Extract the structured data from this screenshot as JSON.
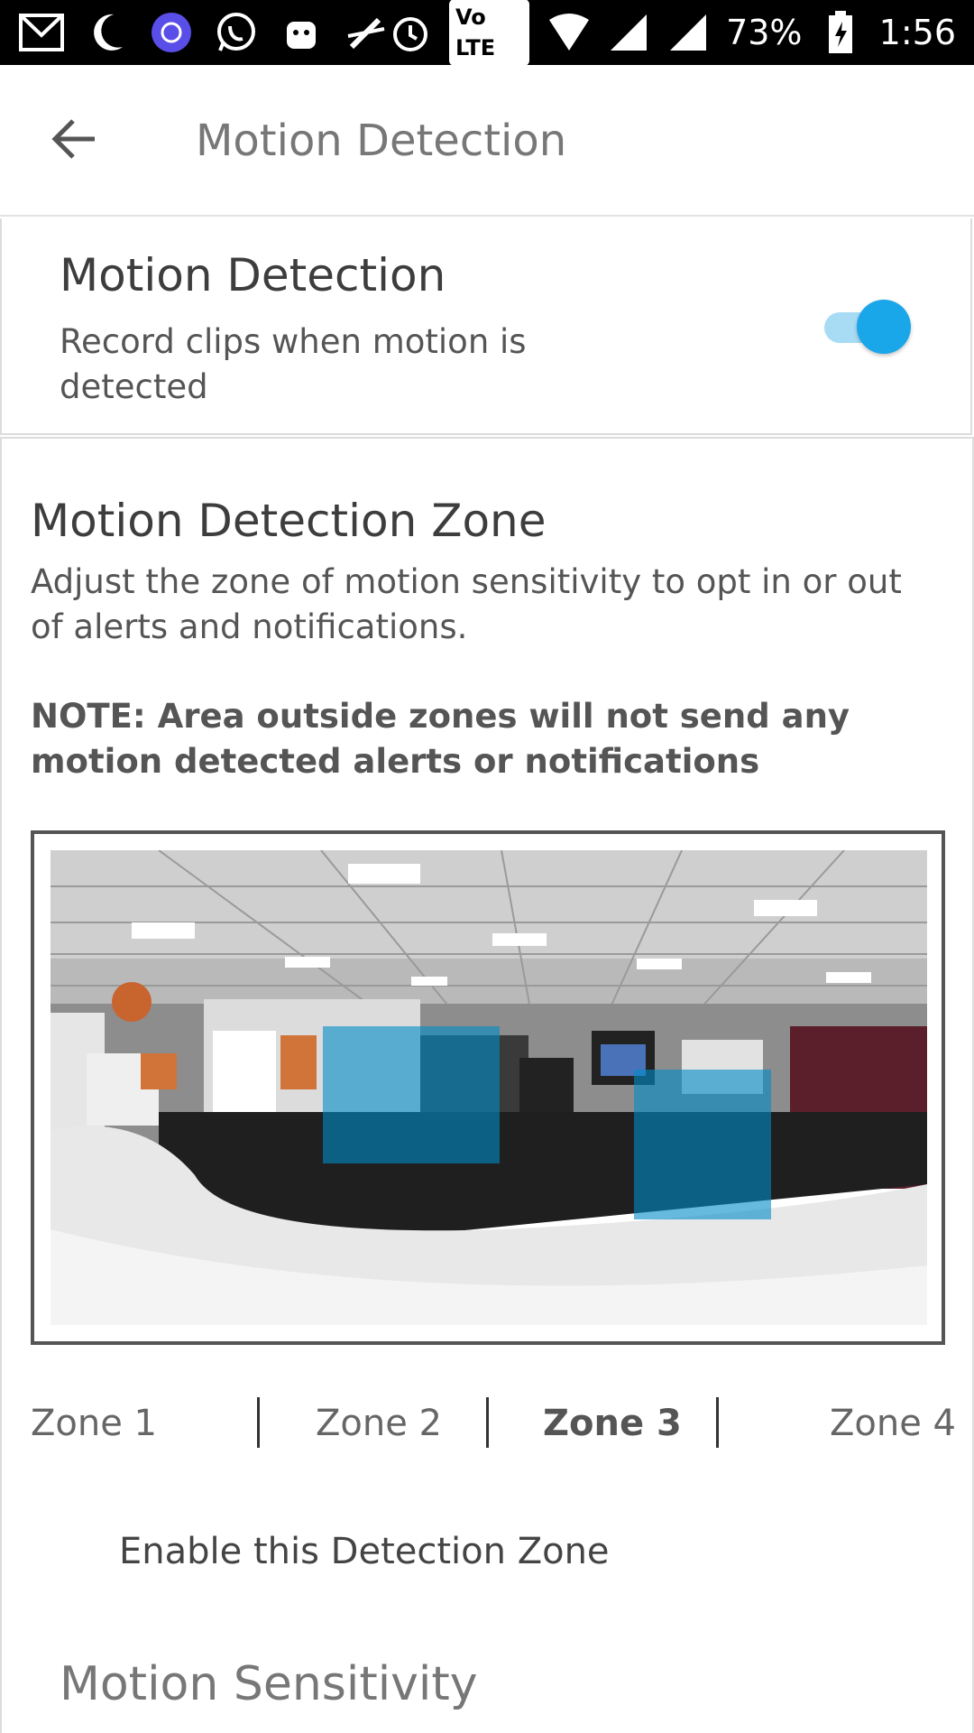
{
  "status_bar": {
    "battery": "73%",
    "time": "1:56",
    "network_badge": "Vo LTE",
    "icons": [
      "gmail-icon",
      "moon-icon",
      "news-icon",
      "whatsapp-icon",
      "android-icon",
      "pen-off-icon",
      "alarm-icon",
      "wifi-icon",
      "signal-icon",
      "signal-icon",
      "battery-charging-icon"
    ]
  },
  "app_bar": {
    "title": "Motion Detection"
  },
  "motion_detection": {
    "title": "Motion Detection",
    "subtitle": "Record clips when motion is detected",
    "enabled": true,
    "toggle_color": "#1aa7ea"
  },
  "zone_section": {
    "title": "Motion Detection Zone",
    "description": "Adjust the zone of motion sensitivity to opt in or out of alerts and notifications.",
    "note": "NOTE: Area outside zones will not send any motion detected alerts or notifications",
    "zone_overlay_color": "#008cc8",
    "tabs": [
      {
        "label": "Zone 1",
        "active": false
      },
      {
        "label": "Zone 2",
        "active": false
      },
      {
        "label": "Zone 3",
        "active": true
      },
      {
        "label": "Zone 4",
        "active": false
      }
    ],
    "enable_label": "Enable this Detection Zone"
  },
  "sensitivity": {
    "title": "Motion Sensitivity"
  }
}
